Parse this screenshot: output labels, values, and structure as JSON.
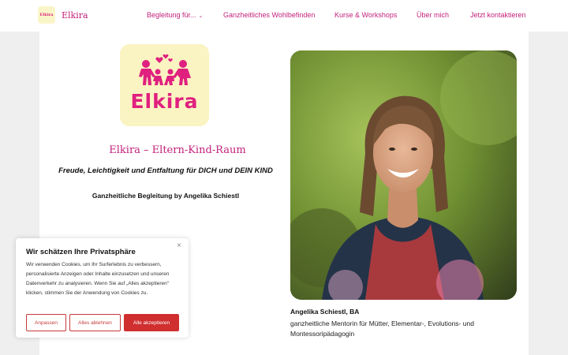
{
  "brand": {
    "name": "Elkira",
    "logo_text": "Elkira"
  },
  "nav": {
    "items": [
      {
        "label": "Begleitung für..."
      },
      {
        "label": "Ganzheitliches Wohlbefinden"
      },
      {
        "label": "Kurse & Workshops"
      },
      {
        "label": "Über mich"
      },
      {
        "label": "Jetzt kontaktieren"
      }
    ]
  },
  "hero": {
    "logo_text": "Elkira",
    "title": "Elkira – Eltern-Kind-Raum",
    "tagline": "Freude, Leichtigkeit und Entfaltung für DICH und DEIN KIND",
    "subline": "Ganzheitliche Begleitung by Angelika Schiestl"
  },
  "photo": {
    "caption_name": "Angelika Schiestl, BA",
    "caption_role": "ganzheitliche Mentorin für Mütter, Elementar-, Evolutions- und Montessoripädagogin"
  },
  "cookie": {
    "title": "Wir schätzen Ihre Privatsphäre",
    "text": "Wir verwenden Cookies, um Ihr Surferlebnis zu verbessern, personalisierte Anzeigen oder Inhalte einzusetzen und unseren Datenverkehr zu analysieren. Wenn Sie auf „Alles akzeptieren“ klicken, stimmen Sie der Anwendung von Cookies zu.",
    "close": "×",
    "btn_customize": "Anpassen",
    "btn_reject": "Alles ablehnen",
    "btn_accept": "Alle akzeptieren"
  },
  "colors": {
    "brand": "#c2227c",
    "logo_pink": "#e0207f",
    "logo_bg": "#faf3c2",
    "cookie_red": "#d02f2f"
  }
}
